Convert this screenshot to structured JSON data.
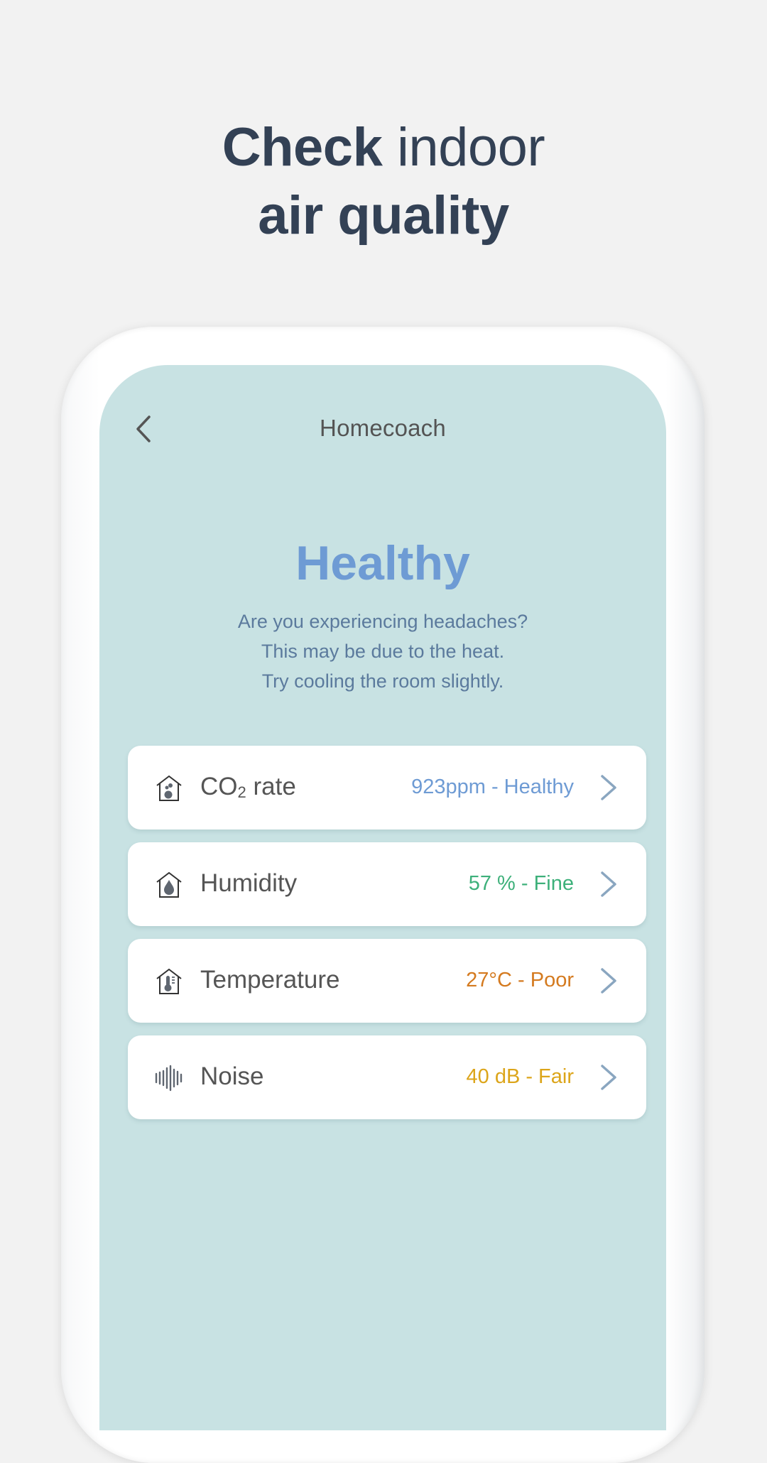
{
  "headline": {
    "line1_bold": "Check",
    "line1_light": " indoor",
    "line2_bold": "air quality"
  },
  "app": {
    "title": "Homecoach",
    "back_icon": "chevron-left-icon"
  },
  "status": {
    "title": "Healthy",
    "description": [
      "Are you experiencing headaches?",
      "This may be due to the heat.",
      "Try cooling the room slightly."
    ]
  },
  "metrics": [
    {
      "icon": "house-co2-icon",
      "label_main": "CO",
      "label_sub": "2",
      "label_rest": " rate",
      "value": "923ppm - Healthy",
      "color": "#6e9bd4"
    },
    {
      "icon": "house-droplet-icon",
      "label_main": "Humidity",
      "label_sub": "",
      "label_rest": "",
      "value": "57 % - Fine",
      "color": "#3db07a"
    },
    {
      "icon": "house-thermometer-icon",
      "label_main": "Temperature",
      "label_sub": "",
      "label_rest": "",
      "value": "27°C - Poor",
      "color": "#d47a1f"
    },
    {
      "icon": "sound-wave-icon",
      "label_main": "Noise",
      "label_sub": "",
      "label_rest": "",
      "value": "40 dB - Fair",
      "color": "#dca51a"
    }
  ],
  "colors": {
    "background": "#f2f2f2",
    "screen": "#c8e2e3",
    "headline": "#334155",
    "status_title": "#6e9bd4",
    "chevron": "#8aa6c0"
  }
}
